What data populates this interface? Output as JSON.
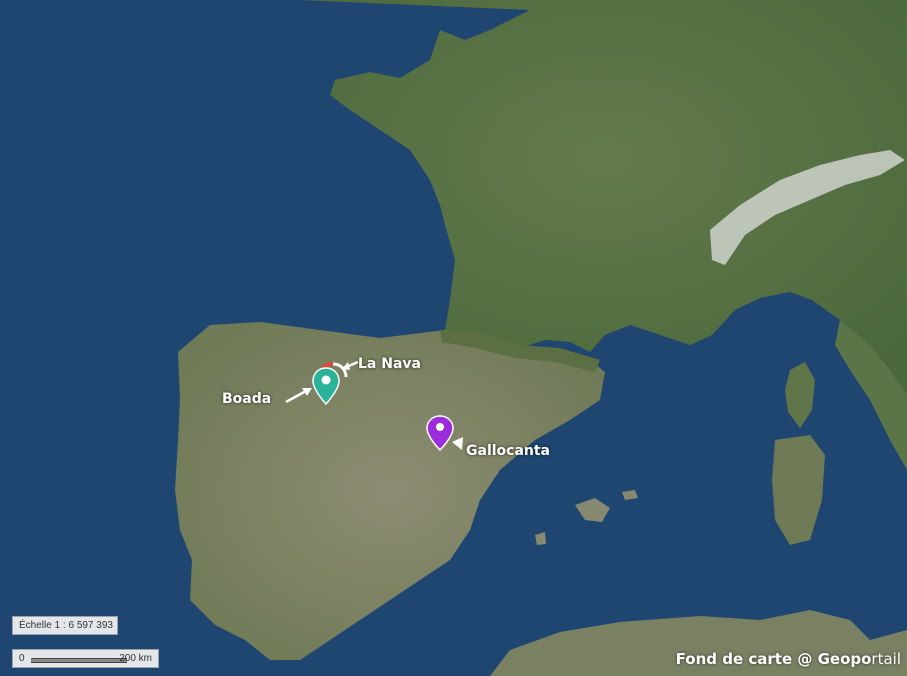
{
  "map": {
    "colors": {
      "sea": "#1e4670",
      "land_green": "#4e6e3f",
      "land_light": "#8a8f72",
      "mountains": "#d8dcd6"
    },
    "markers": [
      {
        "label": "La Nava",
        "color": "#e0453a",
        "icon": "map-pin-icon"
      },
      {
        "label": "Boada",
        "color": "#2bb39a",
        "icon": "map-pin-icon"
      },
      {
        "label": "Gallocanta",
        "color": "#9b2bdb",
        "icon": "map-pin-icon"
      }
    ],
    "scale": {
      "ratio_text": "Échelle 1 : 6 597 393",
      "bar_start": "0",
      "bar_end": "200 km"
    },
    "credit": {
      "bold": "Fond de carte @ Geopo",
      "light": "rtail"
    }
  }
}
